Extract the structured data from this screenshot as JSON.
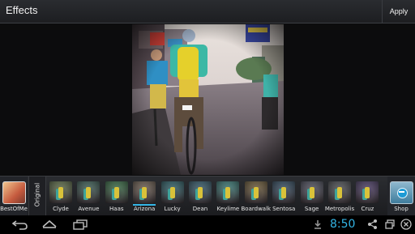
{
  "actionbar": {
    "title": "Effects",
    "apply_label": "Apply"
  },
  "strip": {
    "left_item": {
      "label": "BestOfMe",
      "icon": "bestofme-thumbnail"
    },
    "original_label": "Original",
    "filters": [
      {
        "name": "Clyde",
        "tint": "#7b8a68"
      },
      {
        "name": "Avenue",
        "tint": "#5f7e76"
      },
      {
        "name": "Haas",
        "tint": "#5a8a66"
      },
      {
        "name": "Arizona",
        "tint": "#8a7d70",
        "selected": true
      },
      {
        "name": "Lucky",
        "tint": "#4f7f86"
      },
      {
        "name": "Dean",
        "tint": "#557988"
      },
      {
        "name": "Keylime",
        "tint": "#5a9692"
      },
      {
        "name": "Boardwalk",
        "tint": "#8a7a5a"
      },
      {
        "name": "Sentosa",
        "tint": "#566d80"
      },
      {
        "name": "Sage",
        "tint": "#6d6f7c"
      },
      {
        "name": "Metropolis",
        "tint": "#6c6f73"
      },
      {
        "name": "Cruz",
        "tint": "#6b5e84"
      }
    ],
    "right_item": {
      "label": "Shop",
      "icon": "shop-icon"
    }
  },
  "navbar": {
    "clock": "8:50",
    "back_icon": "back-icon",
    "home_icon": "home-icon",
    "recents_icon": "recent-apps-icon",
    "status_icons": [
      "download-icon",
      "share-icon",
      "screen-icon",
      "close-icon"
    ]
  },
  "colors": {
    "accent": "#33b5e5"
  }
}
